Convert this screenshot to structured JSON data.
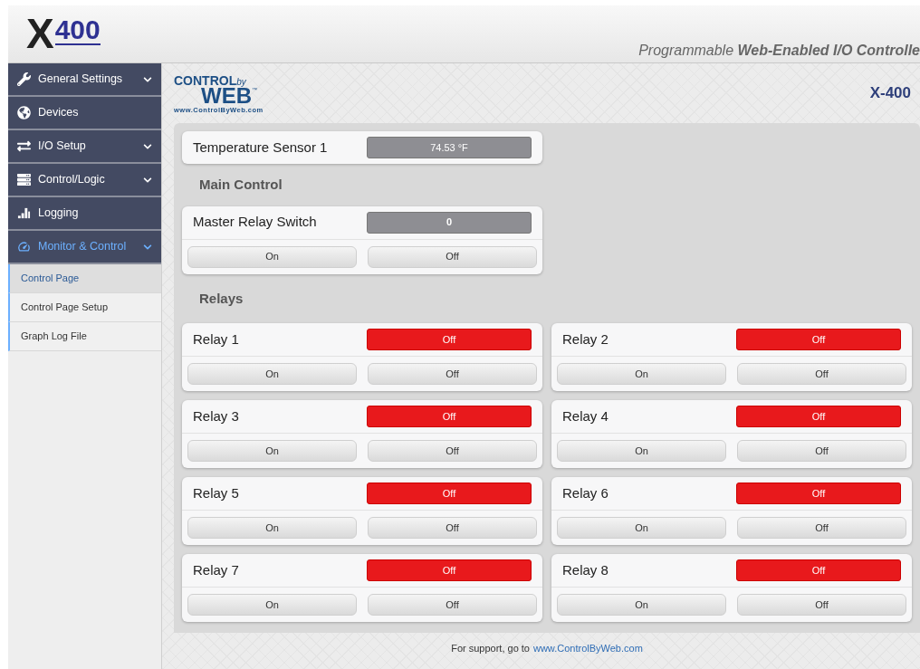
{
  "header": {
    "logo": {
      "mark": "X",
      "number": "400"
    },
    "tagline": "Programmable **Web-Enabled I/O Controlle**"
  },
  "sidebar": {
    "items": [
      {
        "label": "General Settings",
        "expandable": true,
        "selected": false
      },
      {
        "label": "Devices",
        "expandable": false,
        "selected": false
      },
      {
        "label": "I/O Setup",
        "expandable": true,
        "selected": false
      },
      {
        "label": "Control/Logic",
        "expandable": true,
        "selected": false
      },
      {
        "label": "Logging",
        "expandable": false,
        "selected": false
      },
      {
        "label": "Monitor & Control",
        "expandable": true,
        "selected": true
      }
    ],
    "sub_items": [
      {
        "label": "Control Page",
        "selected": true
      },
      {
        "label": "Control Page Setup",
        "selected": false
      },
      {
        "label": "Graph Log File",
        "selected": false
      }
    ]
  },
  "brand": {
    "control": "CONTROL",
    "by": "by",
    "web": "WEB",
    "tm": "™",
    "url": "www.ControlByWeb.com"
  },
  "device_name": "X-400",
  "sensor": {
    "label": "Temperature Sensor 1",
    "value": "74.53 °F"
  },
  "main_control": {
    "heading": "Main Control",
    "label": "Master Relay Switch",
    "value": "0",
    "buttons": [
      "On",
      "Off"
    ]
  },
  "relays_heading": "Relays",
  "relays": [
    {
      "label": "Relay 1",
      "state": "Off",
      "on": false,
      "buttons": [
        "On",
        "Off"
      ]
    },
    {
      "label": "Relay 2",
      "state": "Off",
      "on": false,
      "buttons": [
        "On",
        "Off"
      ]
    },
    {
      "label": "Relay 3",
      "state": "Off",
      "on": false,
      "buttons": [
        "On",
        "Off"
      ]
    },
    {
      "label": "Relay 4",
      "state": "Off",
      "on": false,
      "buttons": [
        "On",
        "Off"
      ]
    },
    {
      "label": "Relay 5",
      "state": "Off",
      "on": false,
      "buttons": [
        "On",
        "Off"
      ]
    },
    {
      "label": "Relay 6",
      "state": "Off",
      "on": false,
      "buttons": [
        "On",
        "Off"
      ]
    },
    {
      "label": "Relay 7",
      "state": "Off",
      "on": false,
      "buttons": [
        "On",
        "Off"
      ]
    },
    {
      "label": "Relay 8",
      "state": "Off",
      "on": false,
      "buttons": [
        "On",
        "Off"
      ]
    }
  ],
  "footer": {
    "text": "For support, go to",
    "link": "www.ControlByWeb.com"
  }
}
